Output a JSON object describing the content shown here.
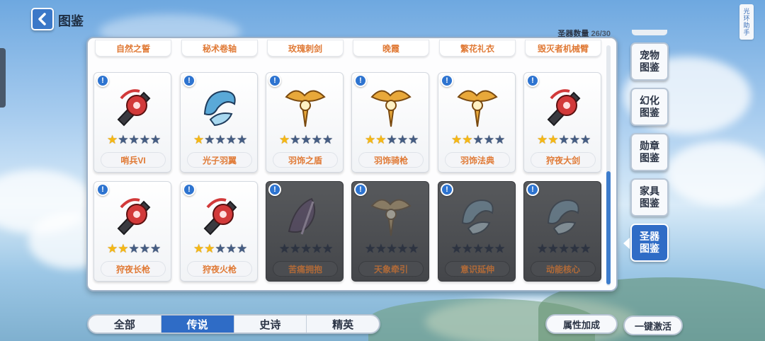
{
  "header": {
    "title": "图鉴",
    "helper_tab": "光环助手"
  },
  "collection": {
    "label": "圣器数量",
    "value": "26/30"
  },
  "top_row": [
    "自然之誓",
    "秘术卷轴",
    "玫瑰刺剑",
    "晚霞",
    "繁花礼衣",
    "毁灭者机械臂"
  ],
  "cards": [
    {
      "name": "哨兵VI",
      "stars": 1,
      "max_stars": 5,
      "locked": false,
      "theme": "red"
    },
    {
      "name": "光子羽翼",
      "stars": 1,
      "max_stars": 5,
      "locked": false,
      "theme": "blue"
    },
    {
      "name": "羽饰之盾",
      "stars": 1,
      "max_stars": 5,
      "locked": false,
      "theme": "gold"
    },
    {
      "name": "羽饰骑枪",
      "stars": 2,
      "max_stars": 5,
      "locked": false,
      "theme": "gold"
    },
    {
      "name": "羽饰法典",
      "stars": 2,
      "max_stars": 5,
      "locked": false,
      "theme": "gold"
    },
    {
      "name": "狩夜大剑",
      "stars": 2,
      "max_stars": 5,
      "locked": false,
      "theme": "red"
    },
    {
      "name": "狩夜长枪",
      "stars": 2,
      "max_stars": 5,
      "locked": false,
      "theme": "red"
    },
    {
      "name": "狩夜火枪",
      "stars": 2,
      "max_stars": 5,
      "locked": false,
      "theme": "red"
    },
    {
      "name": "苦痛拥抱",
      "stars": 0,
      "max_stars": 5,
      "locked": true,
      "theme": "purple"
    },
    {
      "name": "天象牵引",
      "stars": 0,
      "max_stars": 5,
      "locked": true,
      "theme": "gold"
    },
    {
      "name": "意识延伸",
      "stars": 0,
      "max_stars": 5,
      "locked": true,
      "theme": "blue"
    },
    {
      "name": "动能核心",
      "stars": 0,
      "max_stars": 5,
      "locked": true,
      "theme": "blue"
    }
  ],
  "side_menu": [
    {
      "label": "宠物图鉴",
      "active": false
    },
    {
      "label": "幻化图鉴",
      "active": false
    },
    {
      "label": "勋章图鉴",
      "active": false
    },
    {
      "label": "家具图鉴",
      "active": false
    },
    {
      "label": "圣器图鉴",
      "active": true
    }
  ],
  "tabs": [
    {
      "label": "全部",
      "active": false
    },
    {
      "label": "传说",
      "active": true
    },
    {
      "label": "史诗",
      "active": false
    },
    {
      "label": "精英",
      "active": false
    }
  ],
  "buttons": {
    "attribute_bonus": "属性加成",
    "activate_all": "一键激活"
  },
  "theme_colors": {
    "red": "#d23a3a",
    "blue": "#5aa9d8",
    "gold": "#e8a83a",
    "purple": "#6a3d8c",
    "accent": "#2f6cc6"
  }
}
